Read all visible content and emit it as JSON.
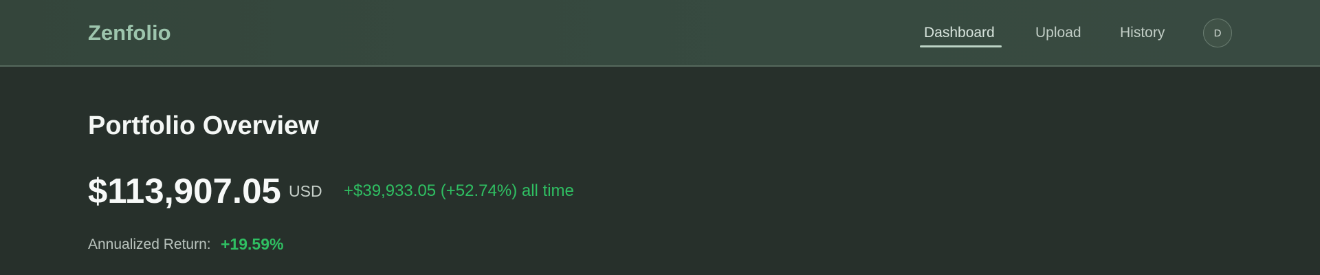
{
  "app": {
    "brand": "Zenfolio"
  },
  "nav": {
    "items": [
      {
        "label": "Dashboard",
        "active": true
      },
      {
        "label": "Upload",
        "active": false
      },
      {
        "label": "History",
        "active": false
      }
    ],
    "avatar_initial": "D"
  },
  "overview": {
    "title": "Portfolio Overview",
    "total_value": "$113,907.05",
    "currency": "USD",
    "all_time_change": "+$39,933.05 (+52.74%) all time",
    "annualized_return_label": "Annualized Return:",
    "annualized_return_value": "+19.59%"
  },
  "colors": {
    "accent": "#9dc5ad",
    "gain": "#2fbf62",
    "header_bg": "#374a40",
    "page_bg": "#27302b"
  }
}
